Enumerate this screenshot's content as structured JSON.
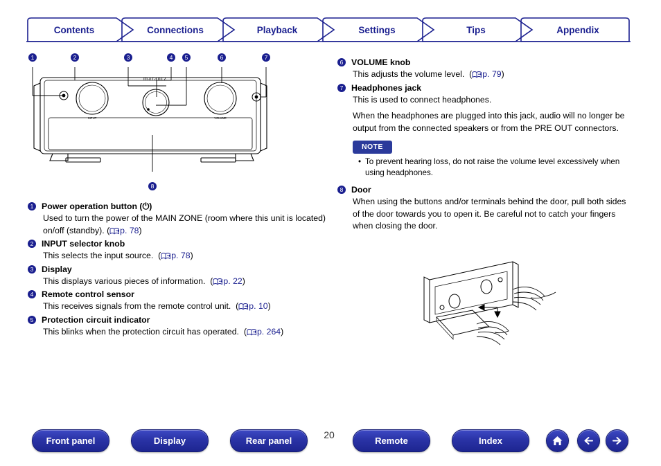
{
  "tabs": [
    {
      "label": "Contents"
    },
    {
      "label": "Connections"
    },
    {
      "label": "Playback"
    },
    {
      "label": "Settings"
    },
    {
      "label": "Tips"
    },
    {
      "label": "Appendix"
    }
  ],
  "brand": "marantz",
  "callouts": [
    "1",
    "2",
    "3",
    "4",
    "5",
    "6",
    "7",
    "8"
  ],
  "left_items": [
    {
      "num": "1",
      "title": "Power operation button (⏻)",
      "body": "Used to turn the power of the MAIN ZONE (room where this unit is located) on/off (standby).",
      "ref": "p. 78"
    },
    {
      "num": "2",
      "title": "INPUT selector knob",
      "body": "This selects the input source.",
      "ref": "p. 78"
    },
    {
      "num": "3",
      "title": "Display",
      "body": "This displays various pieces of information.",
      "ref": "p. 22"
    },
    {
      "num": "4",
      "title": "Remote control sensor",
      "body": "This receives signals from the remote control unit.",
      "ref": "p. 10"
    },
    {
      "num": "5",
      "title": "Protection circuit indicator",
      "body": "This blinks when the protection circuit has operated.",
      "ref": "p. 264"
    }
  ],
  "right_items": [
    {
      "num": "6",
      "title": "VOLUME knob",
      "body": "This adjusts the volume level.",
      "ref": "p. 79"
    },
    {
      "num": "7",
      "title": "Headphones jack",
      "body": "This is used to connect headphones.",
      "body2": "When the headphones are plugged into this jack, audio will no longer be output from the connected speakers or from the PRE OUT connectors.",
      "ref": ""
    },
    {
      "num": "8",
      "title": "Door",
      "body": "When using the buttons and/or terminals behind the door, pull both sides of the door towards you to open it. Be careful not to catch your fingers when closing the door.",
      "ref": ""
    }
  ],
  "note": {
    "label": "NOTE",
    "text": "To prevent hearing loss, do not raise the volume level excessively when using headphones."
  },
  "bottom_nav": {
    "buttons": [
      {
        "label": "Front panel"
      },
      {
        "label": "Display"
      },
      {
        "label": "Rear panel"
      },
      {
        "label": "Remote"
      },
      {
        "label": "Index"
      }
    ],
    "page": "20",
    "icons": [
      "home-icon",
      "back-arrow-icon",
      "forward-arrow-icon"
    ]
  },
  "colors": {
    "accent": "#1a1f8f",
    "button": "#2a33a6",
    "note_badge": "#2b3a9b"
  }
}
